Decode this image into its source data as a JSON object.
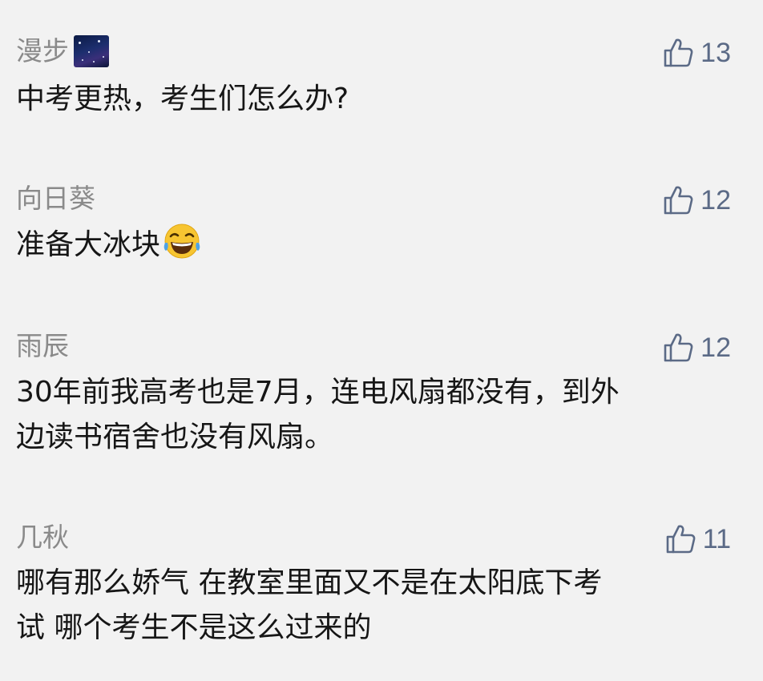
{
  "comments": [
    {
      "username": "漫步",
      "has_avatar_badge": true,
      "likes": "13",
      "lines": [
        "中考更热，考生们怎么办?"
      ]
    },
    {
      "username": "向日葵",
      "likes": "12",
      "lines": [
        "准备大冰块"
      ],
      "trailing_emoji": "laughing-tears-emoji"
    },
    {
      "username": "雨辰",
      "likes": "12",
      "lines": [
        "30年前我高考也是7月，连电风扇都没有，到外",
        "边读书宿舍也没有风扇。"
      ]
    },
    {
      "username": "几秋",
      "likes": "11",
      "lines": [
        "哪有那么娇气 在教室里面又不是在太阳底下考",
        "试 哪个考生不是这么过来的"
      ]
    }
  ],
  "icons": {
    "like": "thumbs-up-outline-icon",
    "like_color": "#5b6a86"
  }
}
